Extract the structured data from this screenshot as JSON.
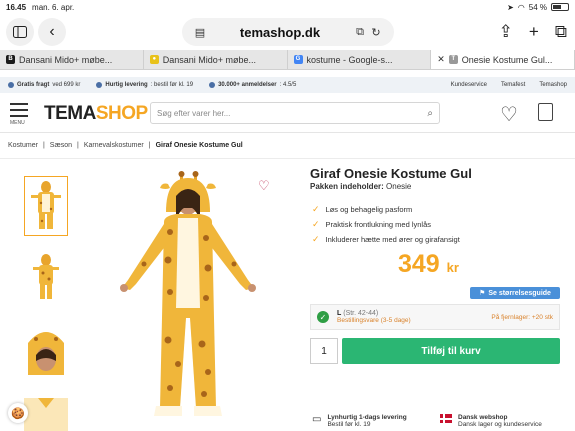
{
  "status": {
    "time": "16.45",
    "date": "man. 6. apr.",
    "battery": "54 %"
  },
  "browser": {
    "url": "temashop.dk",
    "tabs": [
      {
        "label": "Dansani Mido+ møbe...",
        "favicon": "B",
        "color": "#1a1a1a",
        "active": false
      },
      {
        "label": "Dansani Mido+ møbe...",
        "favicon": "●",
        "color": "#e8c21a",
        "active": false
      },
      {
        "label": "kostume - Google-s...",
        "favicon": "G",
        "color": "#4285f4",
        "active": false
      },
      {
        "label": "Onesie Kostume Gul...",
        "favicon": "T",
        "color": "#999999",
        "active": true
      }
    ]
  },
  "usp": {
    "items": [
      {
        "bold": "Gratis fragt",
        "text": "ved 699 kr"
      },
      {
        "bold": "Hurtig levering",
        "text": ": bestil før kl. 19"
      },
      {
        "bold": "30.000+ anmeldelser",
        "text": ": 4.5/5"
      }
    ],
    "links": [
      "Kundeservice",
      "Temafest",
      "Temashop"
    ]
  },
  "header": {
    "menu_label": "MENU",
    "logo_a": "TEMA",
    "logo_b": "SHOP",
    "search_placeholder": "Søg efter varer her..."
  },
  "breadcrumb": [
    "Kostumer",
    "Sæson",
    "Karnevalskostumer",
    "Giraf Onesie Kostume Gul"
  ],
  "product": {
    "title": "Giraf Onesie Kostume Gul",
    "contains_label": "Pakken indeholder:",
    "contains_value": "Onesie",
    "features": [
      "Løs og behagelig pasform",
      "Praktisk frontlukning med lynlås",
      "Inkluderer hætte med ører og girafansigt"
    ],
    "price": "349",
    "currency": "kr",
    "size_guide": "Se størrelsesguide",
    "size": "L",
    "size_range": "(Str. 42-44)",
    "availability": "Bestillingsvare (3-5 dage)",
    "remaining": "På fjernlager: +20 stk",
    "quantity": "1",
    "add_to_cart": "Tilføj til kurv"
  },
  "footer_usp": [
    {
      "title": "Lynhurtig 1-dags levering",
      "text": "Bestil før kl. 19"
    },
    {
      "title": "Dansk webshop",
      "text": "Dansk lager og kundeservice"
    }
  ],
  "colors": {
    "accent": "#f5a623",
    "cart": "#2bb673",
    "guide": "#4a90d9"
  }
}
